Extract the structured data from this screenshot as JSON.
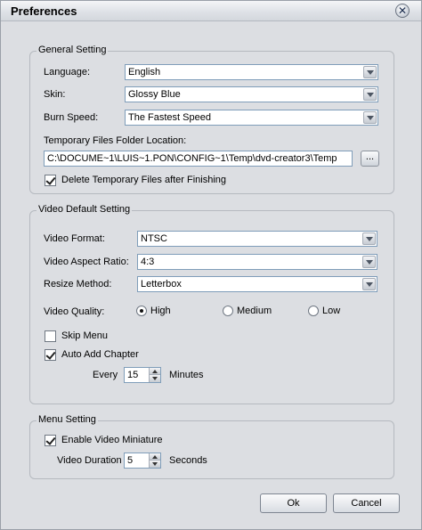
{
  "window": {
    "title": "Preferences"
  },
  "general": {
    "title": "General Setting",
    "language_label": "Language:",
    "language_value": "English",
    "skin_label": "Skin:",
    "skin_value": "Glossy Blue",
    "burn_speed_label": "Burn Speed:",
    "burn_speed_value": "The Fastest Speed",
    "temp_folder_label": "Temporary Files Folder Location:",
    "temp_folder_value": "C:\\DOCUME~1\\LUIS~1.PON\\CONFIG~1\\Temp\\dvd-creator3\\Temp",
    "browse_label": "...",
    "delete_temp_label": "Delete Temporary Files after Finishing",
    "delete_temp_checked": true
  },
  "video": {
    "title": "Video Default Setting",
    "format_label": "Video Format:",
    "format_value": "NTSC",
    "aspect_label": "Video Aspect Ratio:",
    "aspect_value": "4:3",
    "resize_label": "Resize Method:",
    "resize_value": "Letterbox",
    "quality_label": "Video Quality:",
    "quality_options": [
      "High",
      "Medium",
      "Low"
    ],
    "quality_selected": "High",
    "skip_menu_label": "Skip Menu",
    "skip_menu_checked": false,
    "auto_chapter_label": "Auto Add Chapter",
    "auto_chapter_checked": true,
    "every_label": "Every",
    "every_value": "15",
    "minutes_label": "Minutes"
  },
  "menu": {
    "title": "Menu Setting",
    "enable_miniature_label": "Enable Video Miniature",
    "enable_miniature_checked": true,
    "duration_label": "Video Duration",
    "duration_value": "5",
    "seconds_label": "Seconds"
  },
  "buttons": {
    "ok": "Ok",
    "cancel": "Cancel"
  }
}
